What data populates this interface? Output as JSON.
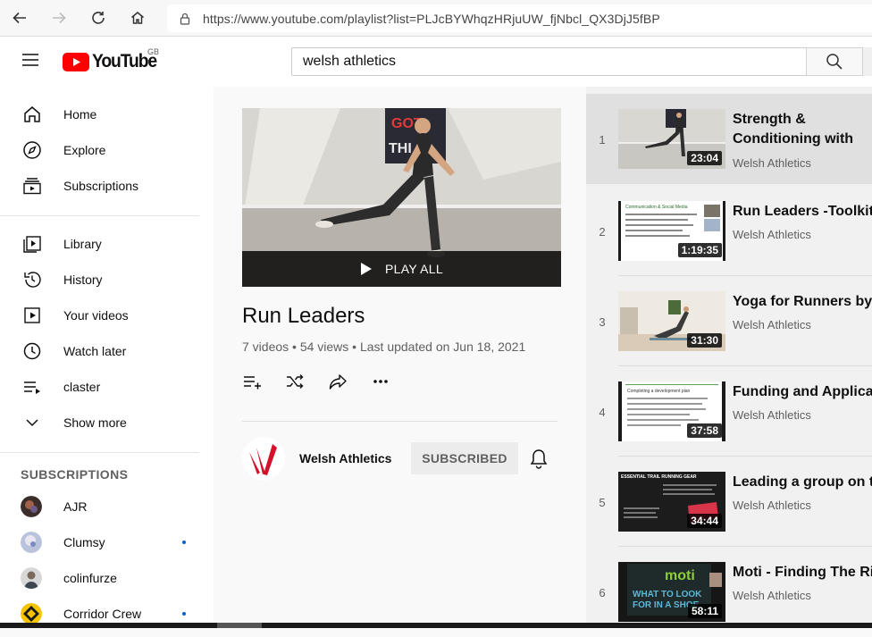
{
  "browser": {
    "url": "https://www.youtube.com/playlist?list=PLJcBYWhqzHRjuUW_fjNbcl_QX3DjJ5fBP"
  },
  "header": {
    "logo_text": "YouTube",
    "country_code": "GB",
    "search_value": "welsh athletics"
  },
  "sidebar": {
    "main": [
      {
        "label": "Home",
        "icon": "home-icon"
      },
      {
        "label": "Explore",
        "icon": "compass-icon"
      },
      {
        "label": "Subscriptions",
        "icon": "subscriptions-icon"
      }
    ],
    "library": [
      {
        "label": "Library",
        "icon": "library-icon"
      },
      {
        "label": "History",
        "icon": "history-icon"
      },
      {
        "label": "Your videos",
        "icon": "your-videos-icon"
      },
      {
        "label": "Watch later",
        "icon": "clock-icon"
      },
      {
        "label": "claster",
        "icon": "playlist-icon"
      },
      {
        "label": "Show more",
        "icon": "chevron-down-icon"
      }
    ],
    "subscriptions_heading": "SUBSCRIPTIONS",
    "subscriptions": [
      {
        "name": "AJR",
        "new": false
      },
      {
        "name": "Clumsy",
        "new": true
      },
      {
        "name": "colinfurze",
        "new": false
      },
      {
        "name": "Corridor Crew",
        "new": true
      }
    ]
  },
  "playlist": {
    "play_all_label": "PLAY ALL",
    "title": "Run Leaders",
    "stats": "7 videos • 54 views • Last updated on Jun 18, 2021",
    "owner_name": "Welsh Athletics",
    "subscribe_label": "SUBSCRIBED"
  },
  "videos": [
    {
      "index": "1",
      "title": "Strength & Conditioning with Kelly",
      "channel": "Welsh Athletics",
      "duration": "23:04"
    },
    {
      "index": "2",
      "title": "Run Leaders -Toolkit",
      "channel": "Welsh Athletics",
      "duration": "1:19:35"
    },
    {
      "index": "3",
      "title": "Yoga for Runners by E",
      "channel": "Welsh Athletics",
      "duration": "31:30"
    },
    {
      "index": "4",
      "title": "Funding and Applicati",
      "channel": "Welsh Athletics",
      "duration": "37:58"
    },
    {
      "index": "5",
      "title": "Leading a group on th",
      "channel": "Welsh Athletics",
      "duration": "34:44"
    },
    {
      "index": "6",
      "title": "Moti - Finding The Rig",
      "channel": "Welsh Athletics",
      "duration": "58:11"
    }
  ],
  "thumb_text": {
    "v2_heading": "Communication & Social Media",
    "v4_heading": "Completing a development plan",
    "v5_heading": "ESSENTIAL TRAIL RUNNING GEAR",
    "v6_brand": "moti",
    "v6_line1": "WHAT TO LOOK",
    "v6_line2": "FOR IN A SHOE"
  },
  "colors": {
    "accent_red": "#ff0000",
    "brand_red": "#d6102a",
    "link_blue": "#065fd4"
  }
}
